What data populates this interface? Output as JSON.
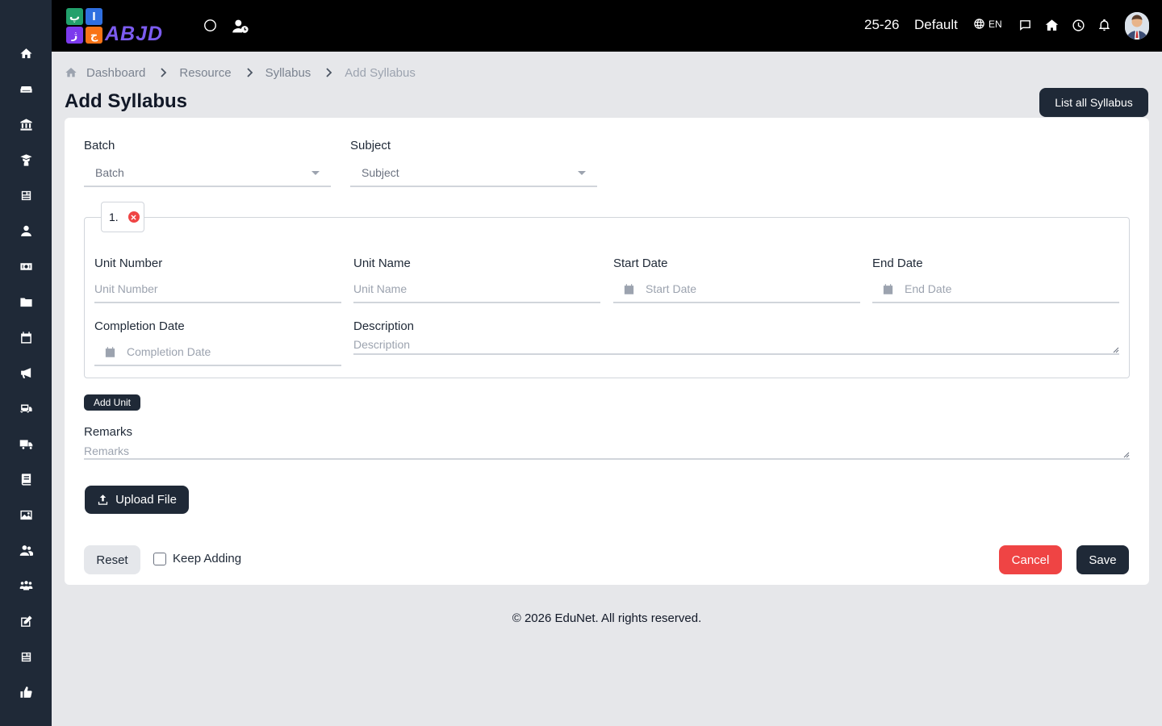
{
  "header": {
    "logo_word": "ABJD",
    "logo_tiles": [
      "پ",
      "ا",
      "ژ",
      "ج"
    ],
    "session": "25-26",
    "profile": "Default",
    "language": "EN"
  },
  "breadcrumb": {
    "items": [
      "Dashboard",
      "Resource",
      "Syllabus",
      "Add Syllabus"
    ]
  },
  "page": {
    "title": "Add Syllabus",
    "list_button": "List all Syllabus"
  },
  "form": {
    "batch": {
      "label": "Batch",
      "value": "Batch"
    },
    "subject": {
      "label": "Subject",
      "value": "Subject"
    },
    "unit": {
      "index": "1.",
      "unit_number": {
        "label": "Unit Number",
        "placeholder": "Unit Number"
      },
      "unit_name": {
        "label": "Unit Name",
        "placeholder": "Unit Name"
      },
      "start_date": {
        "label": "Start Date",
        "placeholder": "Start Date"
      },
      "end_date": {
        "label": "End Date",
        "placeholder": "End Date"
      },
      "completion_date": {
        "label": "Completion Date",
        "placeholder": "Completion Date"
      },
      "description": {
        "label": "Description",
        "placeholder": "Description"
      }
    },
    "add_unit": "Add Unit",
    "remarks": {
      "label": "Remarks",
      "placeholder": "Remarks"
    },
    "upload": "Upload File",
    "reset": "Reset",
    "keep_adding": "Keep Adding",
    "cancel": "Cancel",
    "save": "Save"
  },
  "footer": "© 2026 EduNet. All rights reserved.",
  "colors": {
    "sidebar": "#1f2937",
    "topbar": "#000000",
    "primary": "#1f2937",
    "danger": "#ef4444",
    "background": "#e6e7ea"
  },
  "sidebar_icons": [
    "home-icon",
    "sofa-icon",
    "institution-icon",
    "graduate-icon",
    "newspaper-icon",
    "user-icon",
    "money-icon",
    "folder-icon",
    "calendar-icon",
    "megaphone-icon",
    "bus-icon",
    "truck-icon",
    "book-icon",
    "image-icon",
    "users-icon",
    "people-group-icon",
    "edit-icon",
    "news-icon",
    "thumbs-up-icon"
  ]
}
